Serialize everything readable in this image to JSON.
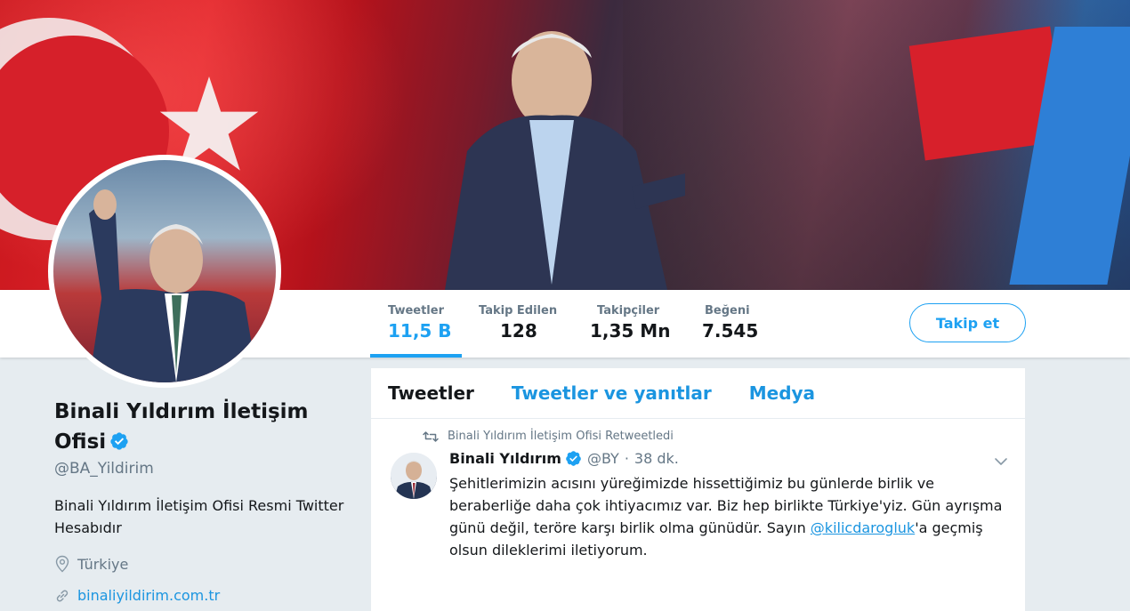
{
  "profile": {
    "name": "Binali Yıldırım İletişim Ofisi",
    "handle": "@BA_Yildirim",
    "bio": "Binali Yıldırım İletişim Ofisi Resmi Twitter Hesabıdır",
    "location": "Türkiye",
    "website": "binaliyildirim.com.tr"
  },
  "stats": [
    {
      "label": "Tweetler",
      "value": "11,5 B"
    },
    {
      "label": "Takip Edilen",
      "value": "128"
    },
    {
      "label": "Takipçiler",
      "value": "1,35 Mn"
    },
    {
      "label": "Beğeni",
      "value": "7.545"
    }
  ],
  "follow_button": "Takip et",
  "tabs": [
    "Tweetler",
    "Tweetler ve yanıtlar",
    "Medya"
  ],
  "tweet": {
    "retweet_context": "Binali Yıldırım İletişim Ofisi Retweetledi",
    "author_name": "Binali Yıldırım",
    "author_handle": "@BY",
    "separator": "·",
    "time": "38 dk.",
    "text_before": "Şehitlerimizin acısını yüreğimizde hissettiğimiz bu günlerde birlik ve beraberliğe daha çok ihtiyacımız var. Biz hep birlikte Türkiye'yiz. Gün ayrışma günü değil, teröre karşı birlik olma günüdür. Sayın ",
    "mention": "@kilicdarogluk",
    "text_after": "'a geçmiş olsun dileklerimi iletiyorum."
  },
  "colors": {
    "accent": "#1da1f2",
    "link": "#1b95e0",
    "muted": "#657786",
    "background": "#e6ecf0"
  }
}
